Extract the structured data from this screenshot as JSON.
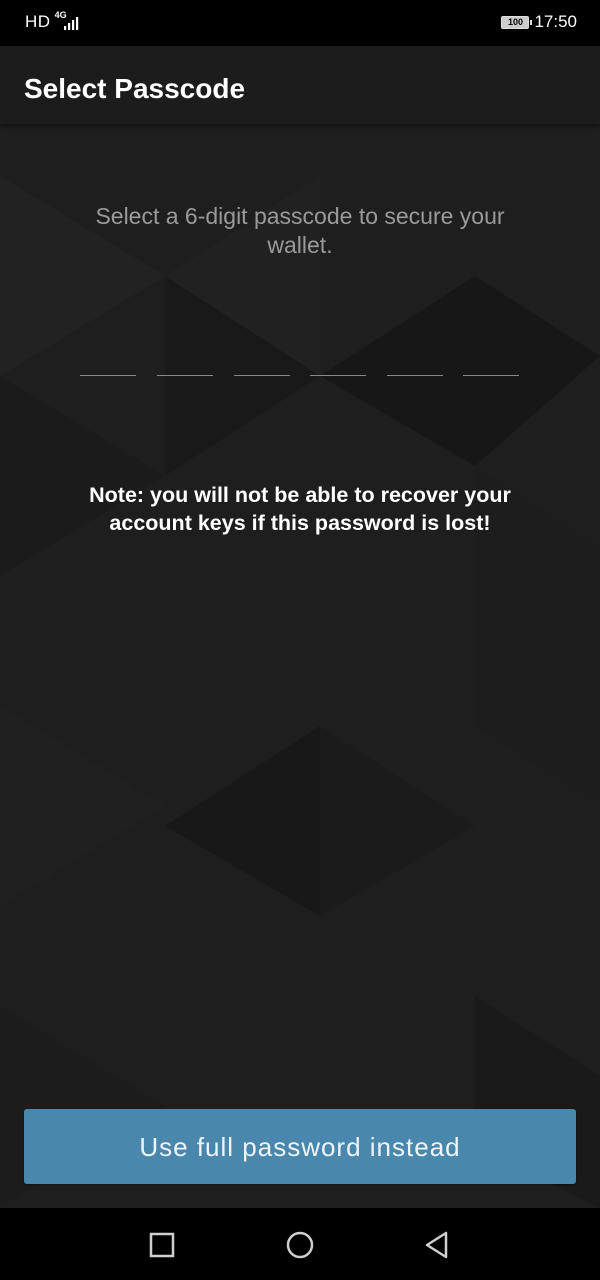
{
  "status_bar": {
    "hd": "HD",
    "network": "4G",
    "battery": "100",
    "time": "17:50"
  },
  "app_bar": {
    "title": "Select Passcode"
  },
  "passcode": {
    "instruction": "Select a 6-digit passcode to secure your wallet.",
    "digits": [
      "",
      "",
      "",
      "",
      "",
      ""
    ],
    "note": "Note: you will not be able to recover your account keys if this password is lost!"
  },
  "actions": {
    "full_password_label": "Use full password instead"
  },
  "nav_bar": {
    "icons": [
      "recent-apps-icon",
      "home-icon",
      "back-icon"
    ]
  },
  "colors": {
    "background": "#1e1e1e",
    "app_bar": "#1c1c1c",
    "accent_button": "#4a87ad",
    "instruction_text": "#9a9a9a"
  }
}
